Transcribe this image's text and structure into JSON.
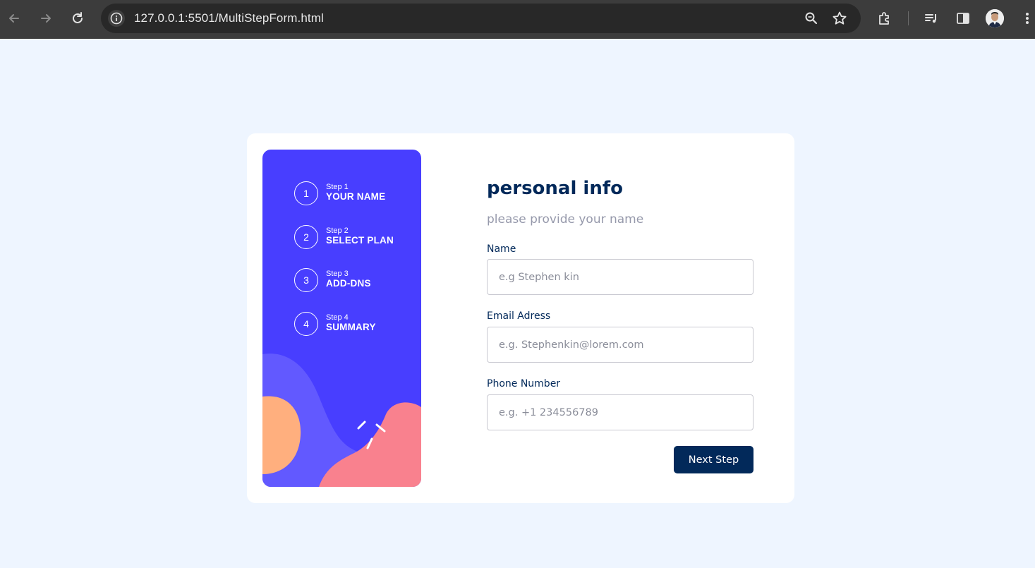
{
  "browser": {
    "url_host": "127.0.0.1",
    "url_rest": ":5501/MultiStepForm.html"
  },
  "sidebar": {
    "steps": [
      {
        "number": "1",
        "small": "Step 1",
        "title": "YOUR NAME"
      },
      {
        "number": "2",
        "small": "Step 2",
        "title": "SELECT PLAN"
      },
      {
        "number": "3",
        "small": "Step 3",
        "title": "ADD-DNS"
      },
      {
        "number": "4",
        "small": "Step 4",
        "title": "SUMMARY"
      }
    ]
  },
  "form": {
    "title": "personal info",
    "subtitle": "please provide your name",
    "name": {
      "label": "Name",
      "placeholder": "e.g Stephen kin",
      "value": ""
    },
    "email": {
      "label": "Email Adress",
      "placeholder": "e.g. Stephenkin@lorem.com",
      "value": ""
    },
    "phone": {
      "label": "Phone Number",
      "placeholder": "e.g. +1 234556789",
      "value": ""
    },
    "next_label": "Next Step"
  },
  "colors": {
    "page_bg": "#eef5ff",
    "sidebar_bg": "#483eff",
    "primary_dark": "#02295a",
    "subtitle_gray": "#9699ab",
    "blob_orange": "#ffaf7e",
    "blob_pink": "#f9818e",
    "blob_violet": "#6259ff"
  },
  "icons": [
    "back-arrow-icon",
    "forward-arrow-icon",
    "reload-icon",
    "site-info-icon",
    "zoom-icon",
    "star-icon",
    "extensions-icon",
    "reading-list-icon",
    "side-panel-icon",
    "profile-avatar-icon",
    "more-menu-icon"
  ]
}
